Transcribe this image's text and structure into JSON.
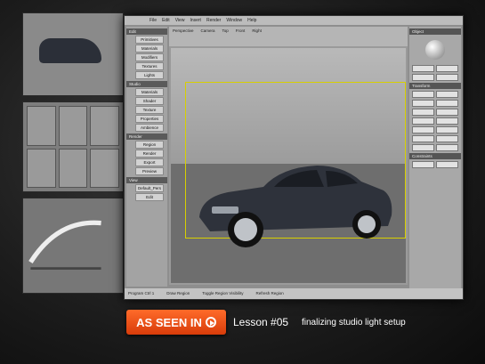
{
  "menu": [
    "File",
    "Edit",
    "View",
    "Insert",
    "Render",
    "Window",
    "Help"
  ],
  "left_sections": [
    {
      "title": "Edit",
      "items": [
        "Primitives",
        "Materials",
        "Modifiers",
        "Textures",
        "Lights"
      ]
    },
    {
      "title": "Studio",
      "items": [
        "Materials",
        "Shader",
        "Texture",
        "Properties",
        "Ambience"
      ]
    },
    {
      "title": "Render",
      "items": [
        "Region",
        "Render",
        "Export",
        "Preview"
      ]
    },
    {
      "title": "View",
      "items": [
        "Default_Pers",
        "Edit"
      ]
    }
  ],
  "viewport": {
    "tabs": [
      "Perspective",
      "Camera",
      "Top",
      "Front",
      "Right"
    ]
  },
  "right_panel": {
    "sections": [
      "Object",
      "Transform",
      "Constraints"
    ]
  },
  "status": [
    "Program Ctrl 1",
    "Draw Region",
    "Toggle Region Visibility",
    "Refresh Region"
  ],
  "banner": {
    "badge": "AS SEEN IN",
    "lesson": "Lesson #05",
    "subtitle": "finalizing studio light setup"
  },
  "colors": {
    "badge": "#e8501a",
    "frame": "#d8d000",
    "car": "#2e323b"
  }
}
